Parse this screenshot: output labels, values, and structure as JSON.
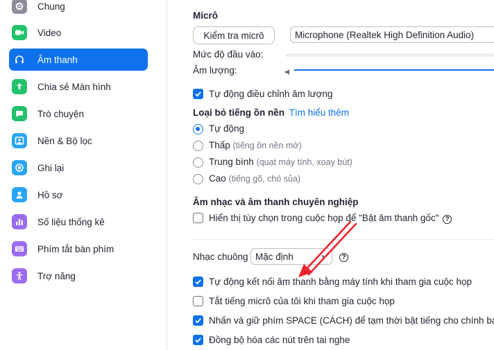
{
  "sidebar": {
    "items": [
      {
        "label": "Chung",
        "icon": "gear-icon",
        "color": "#8e8e9a"
      },
      {
        "label": "Video",
        "icon": "video-icon",
        "color": "#23c16b"
      },
      {
        "label": "Âm thanh",
        "icon": "headphones-icon",
        "color": "#ffffff",
        "active": true
      },
      {
        "label": "Chia sẻ Màn hình",
        "icon": "share-screen-icon",
        "color": "#23c16b"
      },
      {
        "label": "Trò chuyện",
        "icon": "chat-icon",
        "color": "#23c16b"
      },
      {
        "label": "Nền & Bộ lọc",
        "icon": "background-icon",
        "color": "#2aa5f5"
      },
      {
        "label": "Ghi lại",
        "icon": "record-icon",
        "color": "#2aa5f5"
      },
      {
        "label": "Hồ sơ",
        "icon": "profile-icon",
        "color": "#2aa5f5"
      },
      {
        "label": "Số liệu thống kê",
        "icon": "statistics-icon",
        "color": "#9b6cf2"
      },
      {
        "label": "Phím tắt bàn phím",
        "icon": "keyboard-icon",
        "color": "#9b6cf2"
      },
      {
        "label": "Trợ năng",
        "icon": "accessibility-icon",
        "color": "#9b6cf2"
      }
    ]
  },
  "mic": {
    "title": "Micrô",
    "test_button": "Kiểm tra micrô",
    "device": "Microphone (Realtek High Definition Audio)",
    "input_level_label": "Mức độ đầu vào:",
    "volume_label": "Âm lượng:",
    "auto_adjust": "Tự động điều chỉnh âm lượng",
    "auto_adjust_checked": true
  },
  "noise": {
    "title": "Loại bỏ tiếng ồn nền",
    "learn_more": "Tìm hiểu thêm",
    "options": [
      {
        "label": "Tự động",
        "hint": "",
        "selected": true
      },
      {
        "label": "Thấp",
        "hint": "(tiếng ồn nền mờ)",
        "selected": false
      },
      {
        "label": "Trung bình",
        "hint": "(quạt máy tính, xoay bút)",
        "selected": false
      },
      {
        "label": "Cao",
        "hint": "(tiếng gõ, chó sủa)",
        "selected": false
      }
    ]
  },
  "music": {
    "title": "Âm nhạc và âm thanh chuyên nghiệp",
    "show_option": "Hiển thị tùy chọn trong cuộc họp để \"Bật âm thanh gốc\"",
    "show_option_checked": false,
    "help": "?"
  },
  "ringtone": {
    "label": "Nhạc chuông",
    "value": "Mặc định",
    "help": "?"
  },
  "options": [
    {
      "label": "Tự động kết nối âm thanh bằng máy tính khi tham gia cuộc họp",
      "checked": true
    },
    {
      "label": "Tắt tiếng micrô của tôi khi tham gia cuộc họp",
      "checked": false
    },
    {
      "label": "Nhấn và giữ phím SPACE (CÁCH) để tạm thời bật tiếng cho chính bạn",
      "checked": true
    },
    {
      "label": "Đồng bộ hóa các nút trên tai nghe",
      "checked": true
    }
  ],
  "colors": {
    "accent": "#0e72ed",
    "annotation_arrow": "#e8262b"
  }
}
